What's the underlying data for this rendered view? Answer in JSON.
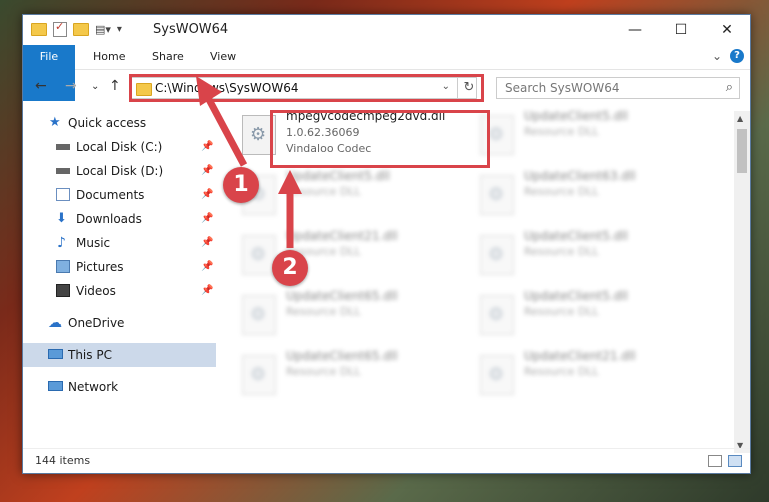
{
  "window": {
    "title": "SysWOW64",
    "caption": {
      "minimize": "—",
      "maximize": "☐",
      "close": "✕"
    }
  },
  "ribbon": {
    "tabs": [
      "File",
      "Home",
      "Share",
      "View"
    ],
    "collapse": "⌄",
    "help": "?"
  },
  "nav": {
    "back": "←",
    "forward": "→",
    "recent": "⌄",
    "up": "↑",
    "address": "C:\\Windows\\SysWOW64",
    "address_dropdown": "⌄",
    "refresh": "↻",
    "search_placeholder": "Search SysWOW64"
  },
  "sidebar": {
    "items": [
      {
        "label": "Quick access",
        "icon": "star-icon",
        "pinned": false
      },
      {
        "label": "Local Disk (C:)",
        "icon": "drive-icon",
        "pinned": true
      },
      {
        "label": "Local Disk (D:)",
        "icon": "drive-icon",
        "pinned": true
      },
      {
        "label": "Documents",
        "icon": "documents-icon",
        "pinned": true
      },
      {
        "label": "Downloads",
        "icon": "download-icon",
        "pinned": true
      },
      {
        "label": "Music",
        "icon": "music-icon",
        "pinned": true
      },
      {
        "label": "Pictures",
        "icon": "pictures-icon",
        "pinned": true
      },
      {
        "label": "Videos",
        "icon": "videos-icon",
        "pinned": true
      },
      {
        "label": "OneDrive",
        "icon": "cloud-icon",
        "pinned": false
      },
      {
        "label": "This PC",
        "icon": "computer-icon",
        "pinned": false,
        "selected": true
      },
      {
        "label": "Network",
        "icon": "network-icon",
        "pinned": false
      }
    ],
    "pin_glyph": "📌"
  },
  "files": {
    "highlighted": {
      "name": "mpegvcodecmpeg2dvd.dll",
      "version": "1.0.62.36069",
      "company": "Vindaloo Codec"
    },
    "blurred": [
      {
        "name": "UpdateClient5.dll",
        "type": "Resource DLL"
      },
      {
        "name": "UpdateClient5.dll",
        "type": "Resource DLL"
      },
      {
        "name": "UpdateClient63.dll",
        "type": "Resource DLL"
      },
      {
        "name": "UpdateClient21.dll",
        "type": "Resource DLL"
      },
      {
        "name": "UpdateClient5.dll",
        "type": "Resource DLL"
      },
      {
        "name": "UpdateClient65.dll",
        "type": "Resource DLL"
      },
      {
        "name": "UpdateClient5.dll",
        "type": "Resource DLL"
      },
      {
        "name": "UpdateClient65.dll",
        "type": "Resource DLL"
      },
      {
        "name": "UpdateClient21.dll",
        "type": "Resource DLL"
      }
    ]
  },
  "status": {
    "items": "144 items"
  },
  "callouts": {
    "one": "1",
    "two": "2"
  },
  "colors": {
    "accent": "#1979ca",
    "highlight": "#d9444a"
  }
}
